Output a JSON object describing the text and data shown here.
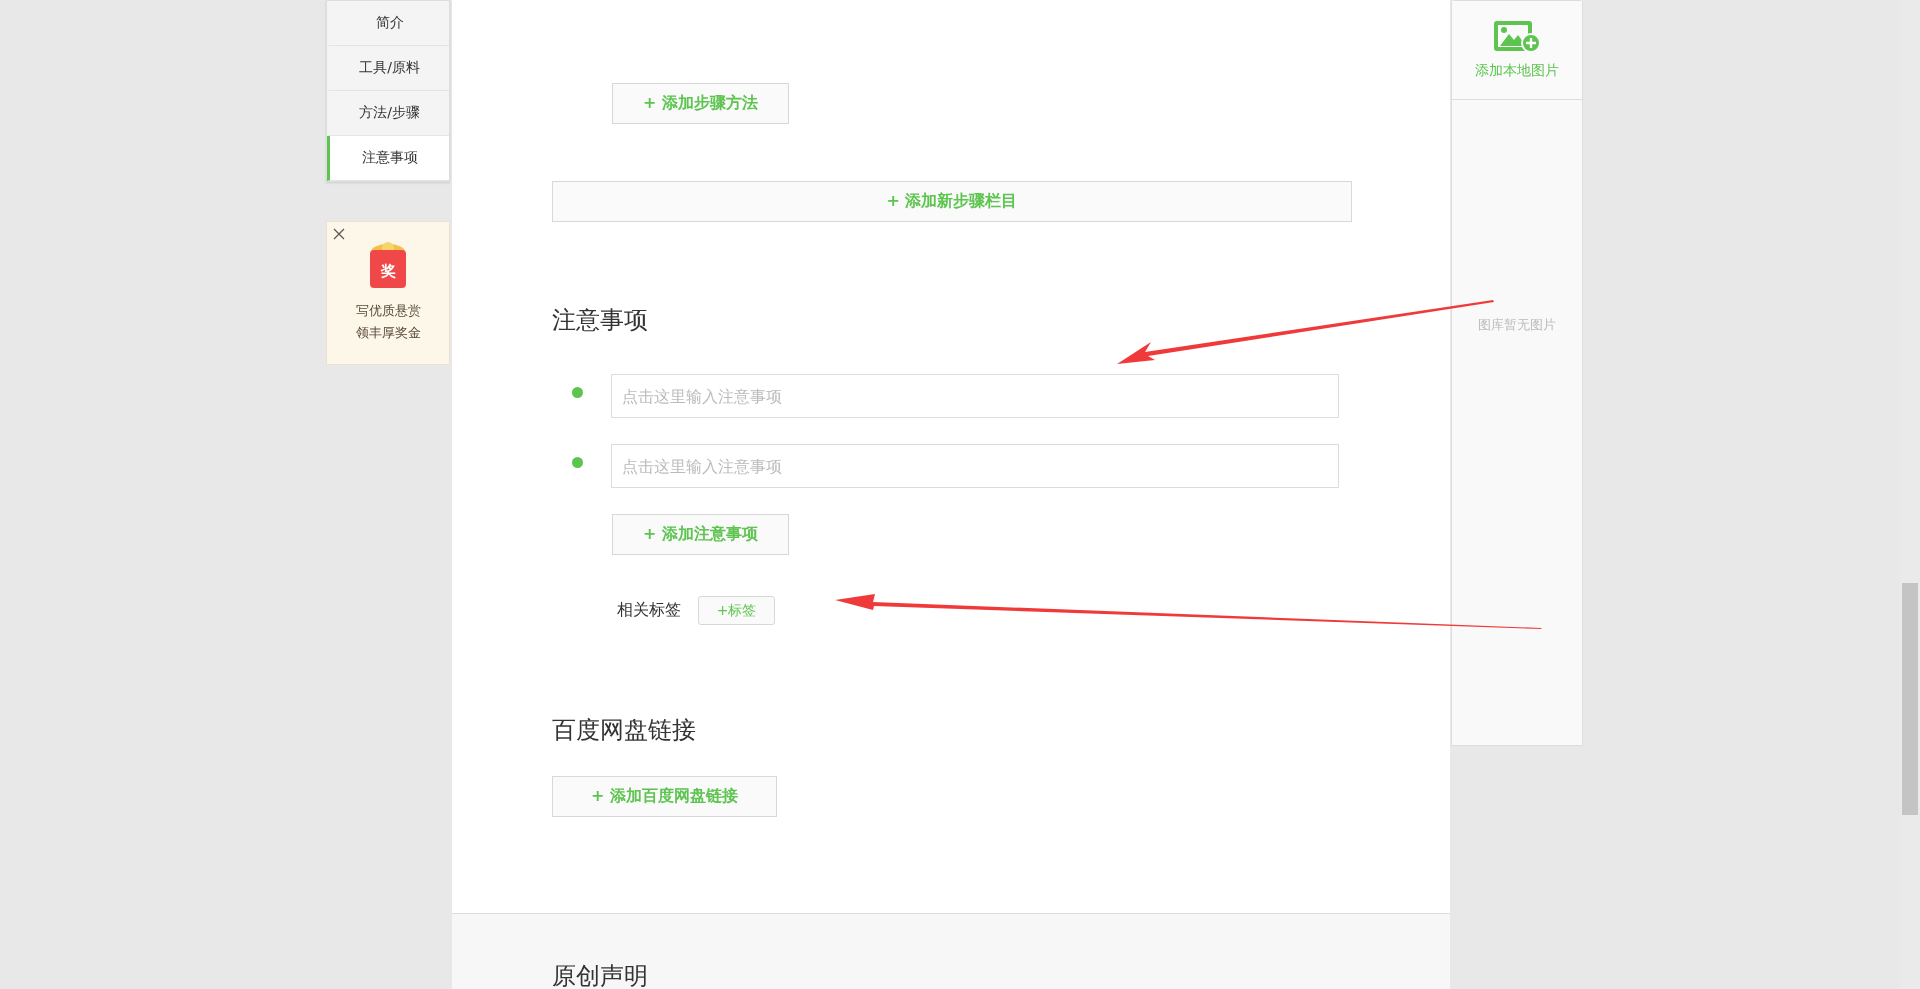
{
  "nav": [
    {
      "label": "简介",
      "selected": false
    },
    {
      "label": "工具/原料",
      "selected": false
    },
    {
      "label": "方法/步骤",
      "selected": false
    },
    {
      "label": "注意事项",
      "selected": true
    }
  ],
  "promo": {
    "badge": "奖",
    "lines": [
      "写优质悬赏",
      "领丰厚奖金"
    ]
  },
  "steps": {
    "add_method_button": "+ 添加步骤方法",
    "add_section_button": "+ 添加新步骤栏目"
  },
  "notes": {
    "title": "注意事项",
    "items": [
      {
        "placeholder": "点击这里输入注意事项"
      },
      {
        "placeholder": "点击这里输入注意事项"
      }
    ],
    "add_button": "+ 添加注意事项"
  },
  "tags": {
    "label": "相关标签",
    "button": "+标签"
  },
  "pan": {
    "title": "百度网盘链接",
    "button": "+ 添加百度网盘链接"
  },
  "declaration": {
    "title": "原创声明"
  },
  "image_panel": {
    "add_button": "添加本地图片",
    "empty_text": "图库暂无图片"
  }
}
